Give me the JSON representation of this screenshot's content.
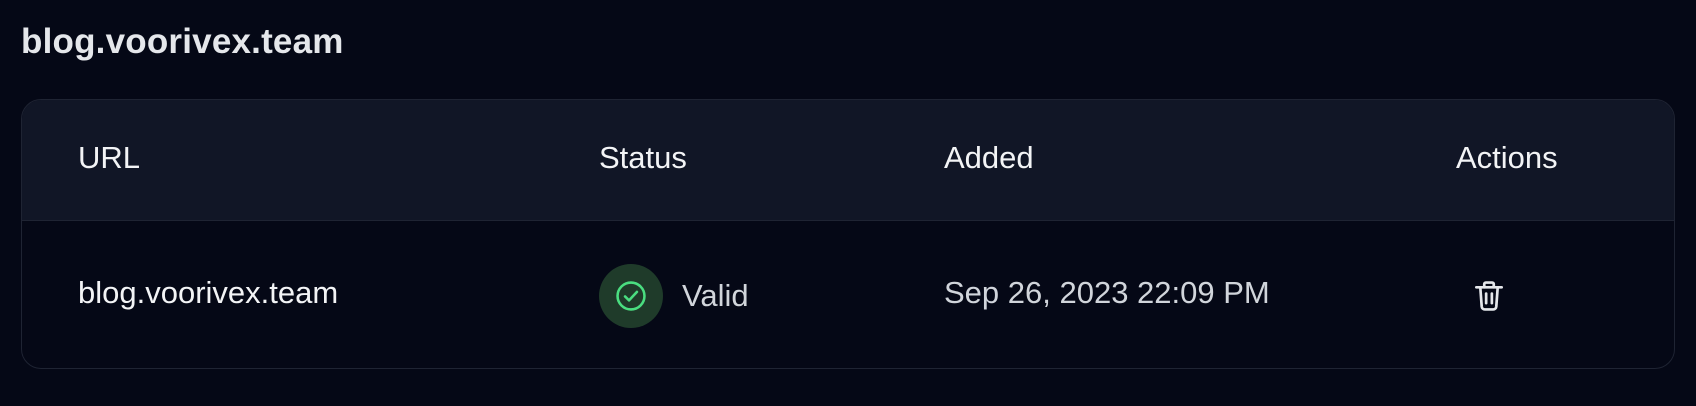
{
  "page": {
    "title": "blog.voorivex.team"
  },
  "table": {
    "headers": {
      "url": "URL",
      "status": "Status",
      "added": "Added",
      "actions": "Actions"
    },
    "rows": [
      {
        "url": "blog.voorivex.team",
        "status": "Valid",
        "status_icon": "check-circle-icon",
        "added": "Sep 26, 2023 22:09 PM",
        "action_icon": "trash-icon"
      }
    ]
  },
  "colors": {
    "background": "#050816",
    "header_background": "#111626",
    "border": "#1f2433",
    "valid_badge_bg": "#1f3b2a",
    "valid_accent": "#4ade80"
  }
}
